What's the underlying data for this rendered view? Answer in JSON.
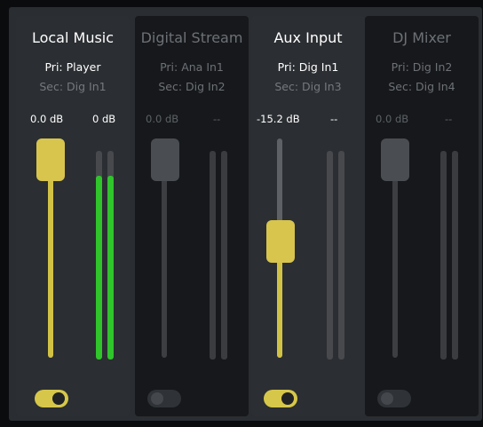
{
  "channels": [
    {
      "name": "Local Music",
      "primary": "Pri: Player",
      "secondary": "Sec: Dig In1",
      "fader_value": "0.0 dB",
      "meter_value": "0 dB",
      "fader_level": 1.0,
      "meter_level": 0.88,
      "enabled": true
    },
    {
      "name": "Digital Stream",
      "primary": "Pri: Ana In1",
      "secondary": "Sec: Dig In2",
      "fader_value": "0.0 dB",
      "meter_value": "--",
      "fader_level": 1.0,
      "meter_level": 0,
      "enabled": false
    },
    {
      "name": "Aux Input",
      "primary": "Pri: Dig In1",
      "secondary": "Sec: Dig In3",
      "fader_value": "-15.2 dB",
      "meter_value": "--",
      "fader_level": 0.54,
      "meter_level": 0,
      "enabled": true
    },
    {
      "name": "DJ Mixer",
      "primary": "Pri: Dig In2",
      "secondary": "Sec: Dig In4",
      "fader_value": "0.0 dB",
      "meter_value": "--",
      "fader_level": 1.0,
      "meter_level": 0,
      "enabled": false
    }
  ],
  "colors": {
    "fader_active": "#d7c54e",
    "meter_green": "#2fc52b",
    "panel_active": "#2b2e32",
    "panel_inactive": "#16181b"
  },
  "icons": {
    "channel_toggle": "toggle-switch-icon"
  }
}
